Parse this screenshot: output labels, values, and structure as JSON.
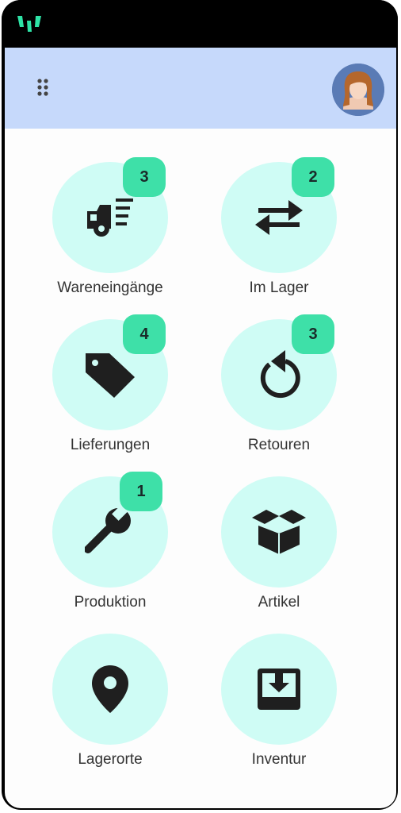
{
  "colors": {
    "appbar_bg": "#c6d9fb",
    "tile_circle": "#cffcf5",
    "badge_bg": "#3ee0a8",
    "icon": "#1f1f1f",
    "logo_accent": "#2ee3a6"
  },
  "header": {
    "menu_icon": "grid-dots-icon",
    "avatar": "user-avatar"
  },
  "tiles": [
    {
      "label": "Wareneingänge",
      "badge": "3",
      "icon": "delivery-truck-icon"
    },
    {
      "label": "Im Lager",
      "badge": "2",
      "icon": "transfer-arrows-icon"
    },
    {
      "label": "Lieferungen",
      "badge": "4",
      "icon": "tag-icon"
    },
    {
      "label": "Retouren",
      "badge": "3",
      "icon": "undo-arrow-icon"
    },
    {
      "label": "Produktion",
      "badge": "1",
      "icon": "wrench-icon"
    },
    {
      "label": "Artikel",
      "icon": "open-box-icon"
    },
    {
      "label": "Lagerorte",
      "icon": "location-pin-icon"
    },
    {
      "label": "Inventur",
      "icon": "download-tray-icon"
    }
  ]
}
